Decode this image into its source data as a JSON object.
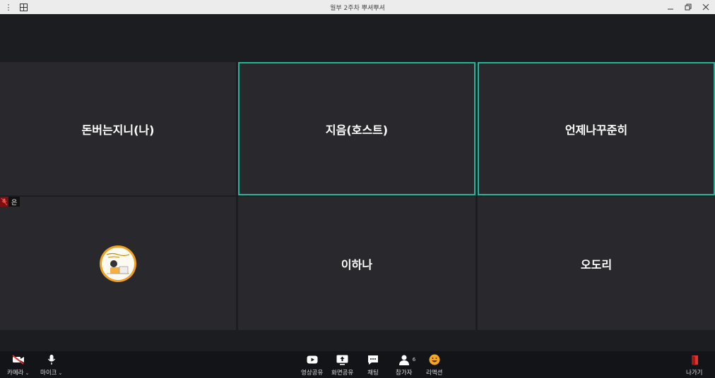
{
  "window": {
    "title": "월부 2주차 뿌셔뿌셔"
  },
  "tiles": [
    {
      "name": "돈버는지니(나)",
      "active": false
    },
    {
      "name": "지음(호스트)",
      "active": true
    },
    {
      "name": "언제나꾸준히",
      "active": true
    },
    {
      "name": "은",
      "active": false,
      "has_avatar": true
    },
    {
      "name": "이하나",
      "active": false
    },
    {
      "name": "오도리",
      "active": false
    }
  ],
  "toolbar": {
    "camera": "카메라",
    "mic": "마이크",
    "video_share": "영상공유",
    "screen_share": "화면공유",
    "chat": "채팅",
    "participants": "참가자",
    "participant_count": "6",
    "reaction": "리액션",
    "leave": "나가기"
  },
  "colors": {
    "active_border": "#22b59a",
    "leave": "#e03030",
    "reaction": "#f5a623"
  }
}
